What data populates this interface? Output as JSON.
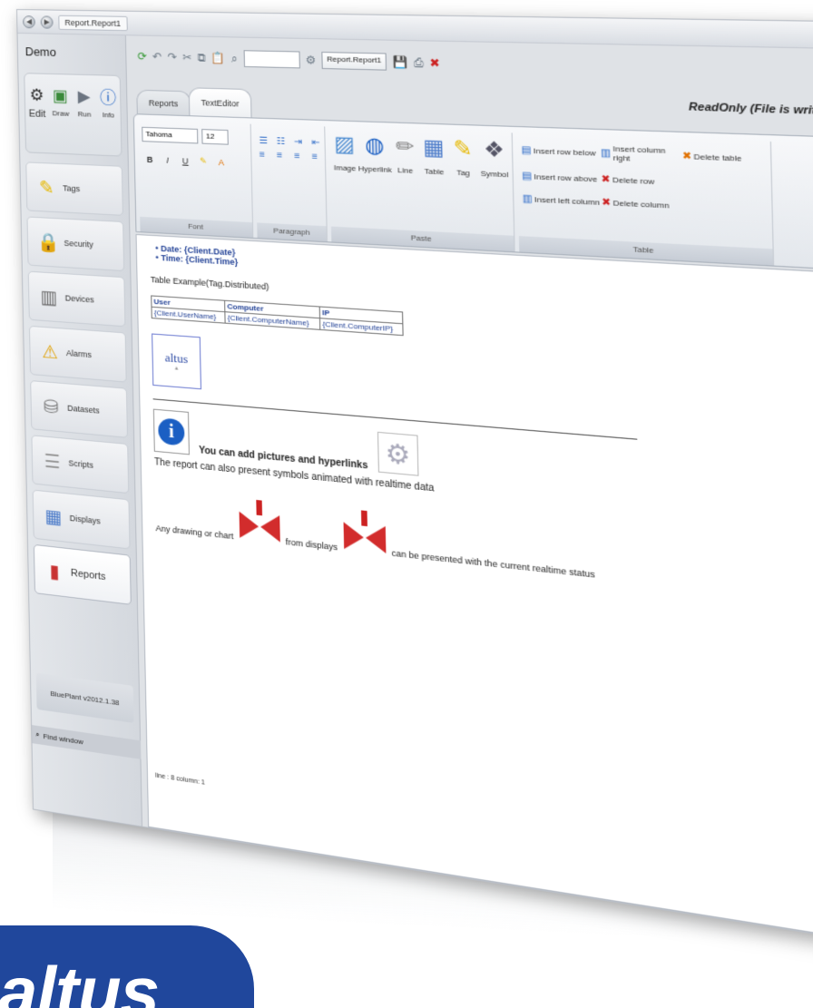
{
  "titlebar": {
    "doc_tab": "Report.Report1"
  },
  "sidebar": {
    "title": "Demo",
    "modes": [
      {
        "label": "Edit",
        "icon": "gear-icon"
      },
      {
        "label": "Draw",
        "icon": "draw-icon"
      },
      {
        "label": "Run",
        "icon": "run-icon"
      },
      {
        "label": "Info",
        "icon": "info-icon"
      }
    ],
    "items": [
      {
        "label": "Tags",
        "icon": "tag-icon"
      },
      {
        "label": "Security",
        "icon": "lock-icon"
      },
      {
        "label": "Devices",
        "icon": "device-icon"
      },
      {
        "label": "Alarms",
        "icon": "alarm-icon"
      },
      {
        "label": "Datasets",
        "icon": "database-icon"
      },
      {
        "label": "Scripts",
        "icon": "script-icon"
      },
      {
        "label": "Displays",
        "icon": "display-icon"
      },
      {
        "label": "Reports",
        "icon": "report-icon"
      }
    ],
    "version": "BluePlant v2012.1.38",
    "find_window": "Find window"
  },
  "toolbar": {
    "report_select": "Report.Report1"
  },
  "tabs": [
    {
      "label": "Reports"
    },
    {
      "label": "TextEditor"
    }
  ],
  "readonly_text": "ReadOnly (File is write-protected)",
  "ribbon": {
    "font": {
      "family": "Tahoma",
      "size": "12",
      "label": "Font",
      "buttons": [
        "B",
        "I",
        "U"
      ]
    },
    "paragraph": {
      "label": "Paragraph"
    },
    "paste": {
      "label": "Paste",
      "items": [
        {
          "label": "Image",
          "icon": "image-icon"
        },
        {
          "label": "Hyperlink",
          "icon": "globe-icon"
        },
        {
          "label": "Line",
          "icon": "pencil-icon"
        },
        {
          "label": "Table",
          "icon": "table-icon"
        },
        {
          "label": "Tag",
          "icon": "tag-icon"
        },
        {
          "label": "Symbol",
          "icon": "symbol-icon"
        }
      ]
    },
    "table": {
      "label": "Table",
      "actions": [
        "Insert row below",
        "Insert column right",
        "Delete table",
        "Insert row above",
        "Delete row",
        "",
        "Insert left column",
        "Delete column",
        ""
      ]
    }
  },
  "document": {
    "bullets": [
      "Date: {Client.Date}",
      "Time: {Client.Time}"
    ],
    "table_example": "Table Example(Tag.Distributed)",
    "table": {
      "headers": [
        "User",
        "Computer",
        "IP"
      ],
      "row": [
        "{Client.UserName}",
        "{Client.ComputerName}",
        "{Client.ComputerIP}"
      ]
    },
    "logo_text": "altus",
    "pictures_text": "You can add pictures and hyperlinks",
    "animated_text": "The report can also present symbols animated with realtime data",
    "drawing_text": "Any drawing or chart",
    "from_displays": "from displays",
    "realtime_text": "can be presented with the current realtime status",
    "status_line": "line : 8 column: 1"
  },
  "brand_logo": "altus"
}
